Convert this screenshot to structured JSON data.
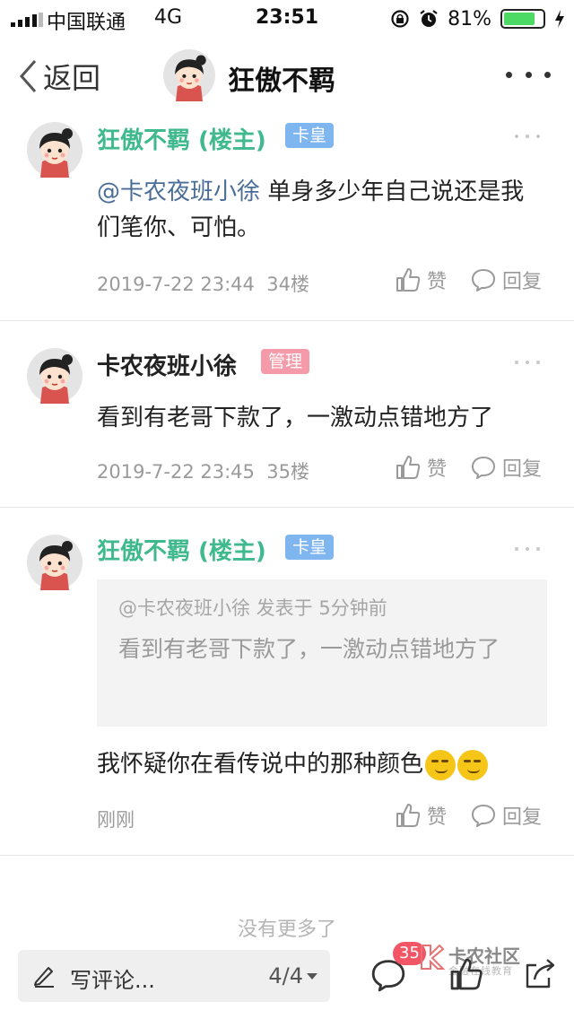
{
  "status_bar": {
    "carrier": "中国联通",
    "network": "4G",
    "time": "23:51",
    "battery_percent": "81%",
    "battery_level": 0.81
  },
  "nav": {
    "back_label": "返回",
    "title": "狂傲不羁"
  },
  "posts": [
    {
      "author": "狂傲不羁 (楼主)",
      "badge": "卡皇",
      "mention": "@卡农夜班小徐",
      "text": " 单身多少年自己说还是我们笔你、可怕。",
      "time": "2019-7-22 23:44",
      "floor": "34楼",
      "like_label": "赞",
      "reply_label": "回复"
    },
    {
      "author": "卡农夜班小徐",
      "badge": "管理",
      "text": "看到有老哥下款了，一激动点错地方了",
      "time": "2019-7-22 23:45",
      "floor": "35楼",
      "like_label": "赞",
      "reply_label": "回复"
    },
    {
      "author": "狂傲不羁 (楼主)",
      "badge": "卡皇",
      "quote_meta": "@卡农夜班小徐 发表于 5分钟前",
      "quote_text": "看到有老哥下款了，一激动点错地方了",
      "text": "我怀疑你在看传说中的那种颜色",
      "time": "刚刚",
      "like_label": "赞",
      "reply_label": "回复"
    }
  ],
  "no_more": "没有更多了",
  "bottom_bar": {
    "comment_placeholder": "写评论...",
    "page": "4/4",
    "comment_count": "35"
  },
  "watermark": {
    "title": "卡农社区",
    "subtitle": "金融在线教育"
  },
  "colors": {
    "accent_green": "#3fb98d",
    "mention_blue": "#4a6d97",
    "badge_blue": "#7fb6ef",
    "badge_pink": "#f49aa8",
    "count_badge": "#f25565"
  }
}
